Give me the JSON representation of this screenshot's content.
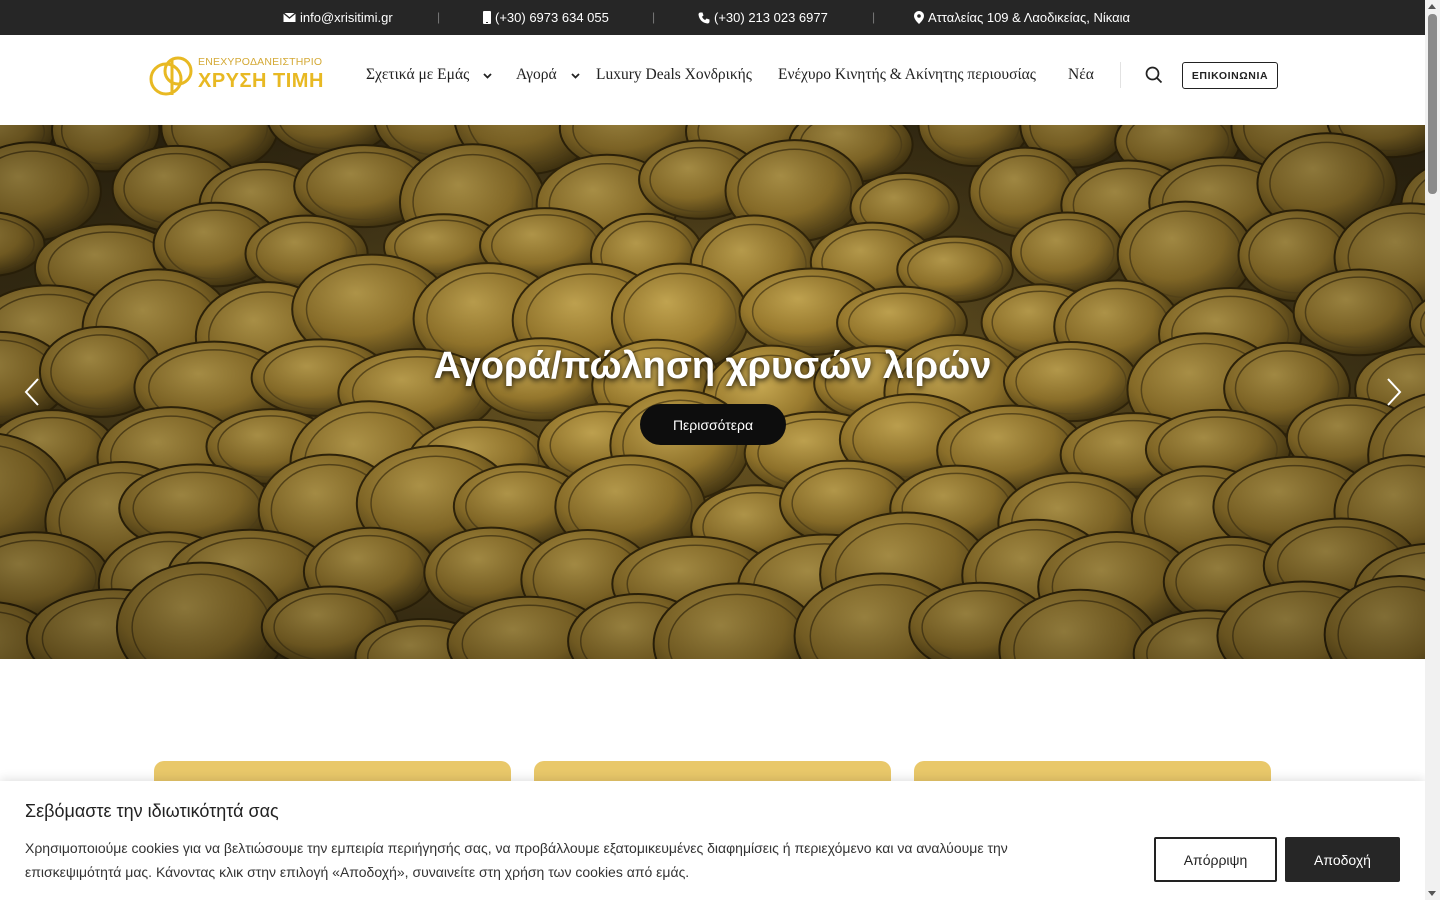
{
  "topbar": {
    "email": "info@xrisitimi.gr",
    "mobile": "(+30) 6973 634 055",
    "phone": "(+30) 213 023 6977",
    "address": "Ατταλείας 109 & Λαοδικείας, Νίκαια",
    "separator": "|"
  },
  "logo": {
    "line1": "ΕΝΕΧΥΡΟΔΑΝΕΙΣΤΗΡΙΟ",
    "line2": "ΧΡΥΣΗ ΤΙΜΗ"
  },
  "nav": {
    "about": "Σχετικά με Εμάς",
    "buy": "Αγορά",
    "luxury": "Luxury Deals Χονδρικής",
    "pledge": "Ενέχυρο Κινητής & Ακίνητης περιουσίας",
    "news": "Νέα",
    "contact": "ΕΠΙΚΟΙΝΩΝΙΑ"
  },
  "hero": {
    "title": "Αγορά/πώληση χρυσών λιρών",
    "button": "Περισσότερα"
  },
  "cookie": {
    "title": "Σεβόμαστε την ιδιωτικότητά σας",
    "text": "Χρησιμοποιούμε cookies για να βελτιώσουμε την εμπειρία περιήγησής σας, να προβάλλουμε εξατομικευμένες διαφημίσεις ή περιεχόμενο και να αναλύουμε την επισκεψιμότητά μας. Κάνοντας κλικ στην επιλογή «Αποδοχή», συναινείτε στη χρήση των cookies από εμάς.",
    "reject": "Απόρριψη",
    "accept": "Αποδοχή"
  },
  "colors": {
    "topbar_bg": "#262626",
    "gold": "#e8b923",
    "card_gold": "#e9c86a",
    "dark_button": "#0d0d0d"
  },
  "icons": [
    "envelope-icon",
    "mobile-phone-icon",
    "phone-icon",
    "map-marker-icon",
    "chevron-down-icon",
    "search-icon",
    "arrow-left-icon",
    "arrow-right-icon"
  ]
}
